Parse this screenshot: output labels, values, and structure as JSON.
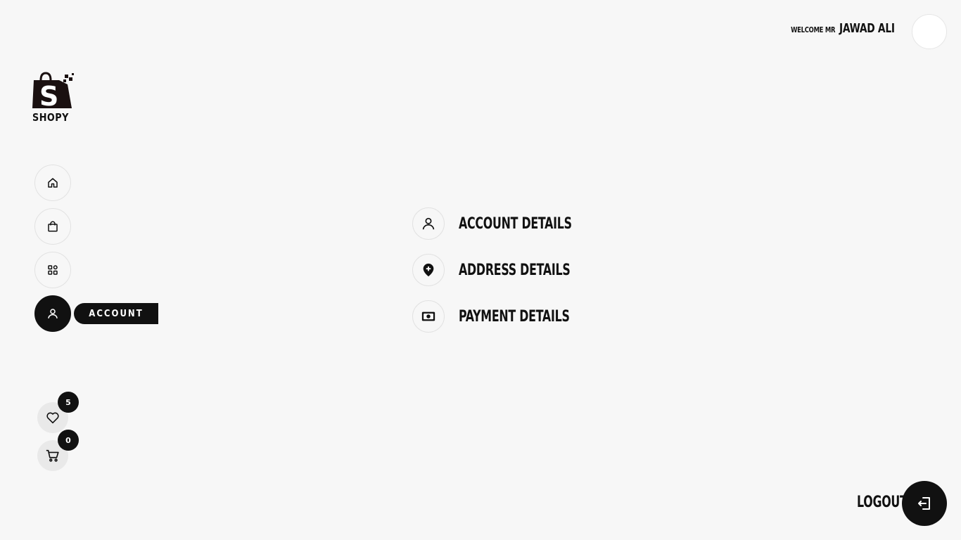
{
  "header": {
    "welcome_prefix": "WELCOME MR",
    "user_name": "JAWAD ALI"
  },
  "brand": {
    "name": "SHOPY",
    "color": "#111111"
  },
  "sidebar": {
    "items": [
      {
        "icon": "home-icon"
      },
      {
        "icon": "shopping-bag-icon"
      },
      {
        "icon": "grid-icon"
      },
      {
        "icon": "user-icon",
        "label": "ACCOUNT",
        "active": true
      }
    ],
    "wishlist": {
      "icon": "heart-icon",
      "count": "5"
    },
    "cart": {
      "icon": "cart-icon",
      "count": "0"
    }
  },
  "account_menu": {
    "items": [
      {
        "icon": "user-icon",
        "label": "ACCOUNT DETAILS"
      },
      {
        "icon": "location-pin-icon",
        "label": "ADDRESS DETAILS"
      },
      {
        "icon": "money-icon",
        "label": "PAYMENT DETAILS"
      }
    ]
  },
  "footer": {
    "logout_label": "LOGOUT",
    "logout_icon": "logout-icon"
  }
}
